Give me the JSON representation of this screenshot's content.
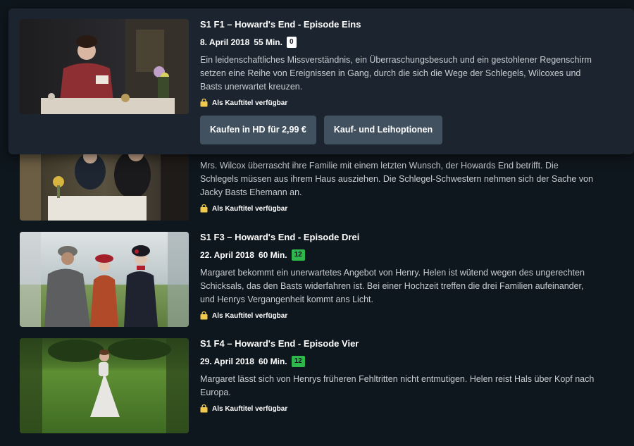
{
  "availability_label": "Als Kauftitel verfügbar",
  "episodes": [
    {
      "title": "S1 F1 – Howard's End - Episode Eins",
      "date": "8. April 2018",
      "duration": "55 Min.",
      "rating": "0",
      "description": "Ein leidenschaftliches Missverständnis, ein Überraschungsbesuch und ein gestohlener Regenschirm setzen eine Reihe von Ereignissen in Gang, durch die sich die Wege der Schlegels, Wilcoxes und Basts unerwartet kreuzen."
    },
    {
      "description": "Mrs. Wilcox überrascht ihre Familie mit einem letzten Wunsch, der Howards End betrifft. Die Schlegels müssen aus ihrem Haus ausziehen. Die Schlegel-Schwestern nehmen sich der Sache von Jacky Basts Ehemann an."
    },
    {
      "title": "S1 F3 – Howard's End - Episode Drei",
      "date": "22. April 2018",
      "duration": "60 Min.",
      "rating": "12",
      "description": "Margaret bekommt ein unerwartetes Angebot von Henry. Helen ist wütend wegen des ungerechten Schicksals, das den Basts widerfahren ist. Bei einer Hochzeit treffen die drei Familien aufeinander, und Henrys Vergangenheit kommt ans Licht."
    },
    {
      "title": "S1 F4 – Howard's End - Episode Vier",
      "date": "29. April 2018",
      "duration": "60 Min.",
      "rating": "12",
      "description": "Margaret lässt sich von Henrys früheren Fehltritten nicht entmutigen. Helen reist Hals über Kopf nach Europa."
    }
  ],
  "buttons": {
    "buy_hd": "Kaufen in HD für 2,99 €",
    "buy_rent_options": "Kauf- und Leihoptionen"
  },
  "colors": {
    "background": "#0f171e",
    "card": "#1c252f",
    "button": "#425160",
    "rating_green": "#2eb84b",
    "bag_yellow": "#f2c94c"
  },
  "icons": {
    "availability": "shopping-bag-icon"
  }
}
